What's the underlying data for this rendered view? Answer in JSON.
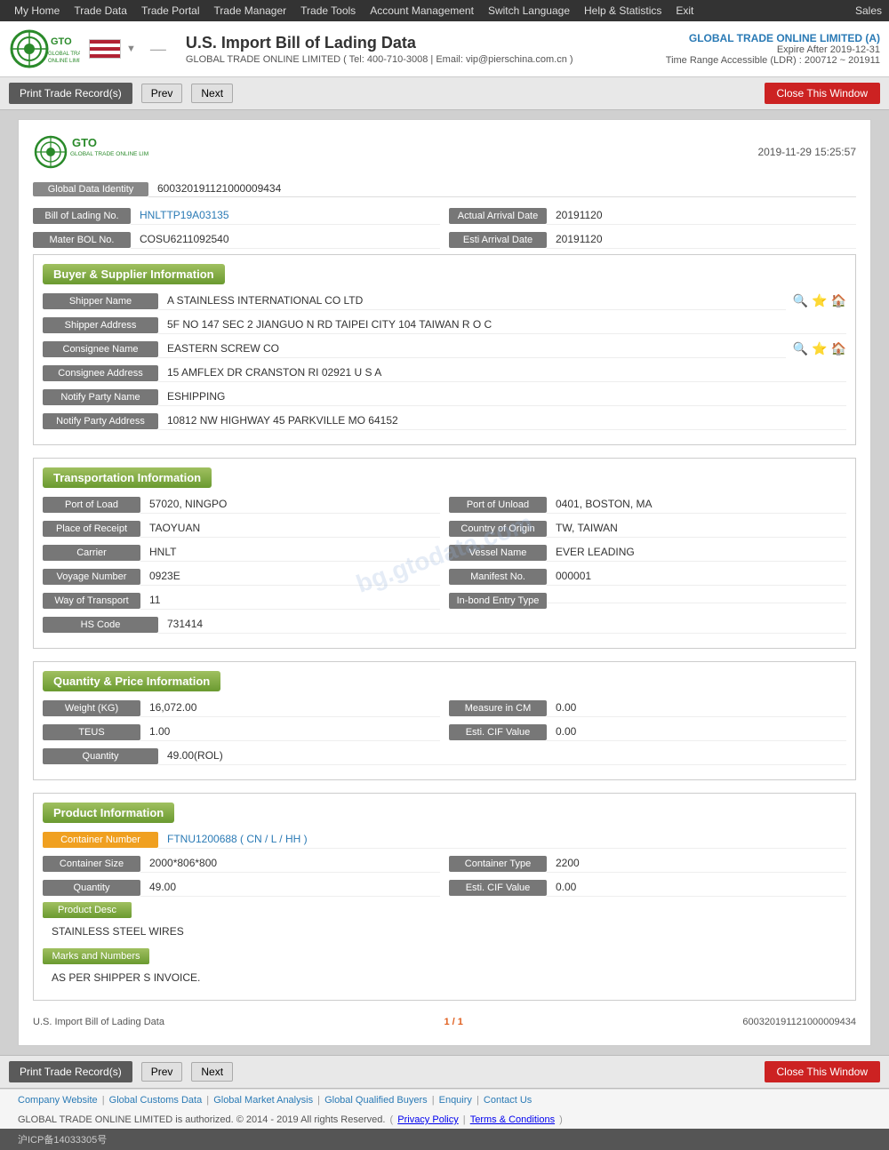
{
  "nav": {
    "items": [
      "My Home",
      "Trade Data",
      "Trade Portal",
      "Trade Manager",
      "Trade Tools",
      "Account Management",
      "Switch Language",
      "Help & Statistics",
      "Exit"
    ],
    "right": "Sales"
  },
  "header": {
    "title": "U.S. Import Bill of Lading Data",
    "subtitle": "GLOBAL TRADE ONLINE LIMITED ( Tel: 400-710-3008 | Email: vip@pierschina.com.cn )",
    "company": "GLOBAL TRADE ONLINE LIMITED (A)",
    "expire": "Expire After 2019-12-31",
    "ldr": "Time Range Accessible (LDR) : 200712 ~ 201911"
  },
  "toolbar": {
    "print_label": "Print Trade Record(s)",
    "prev_label": "Prev",
    "next_label": "Next",
    "close_label": "Close This Window"
  },
  "record": {
    "date": "2019-11-29 15:25:57",
    "global_data_identity_label": "Global Data Identity",
    "global_data_identity_value": "600320191121000009434",
    "bill_of_lading_no_label": "Bill of Lading No.",
    "bill_of_lading_no_value": "HNLTTP19A03135",
    "actual_arrival_date_label": "Actual Arrival Date",
    "actual_arrival_date_value": "20191120",
    "mater_bol_no_label": "Mater BOL No.",
    "mater_bol_no_value": "COSU6211092540",
    "esti_arrival_date_label": "Esti Arrival Date",
    "esti_arrival_date_value": "20191120"
  },
  "buyer_supplier": {
    "section_label": "Buyer & Supplier Information",
    "shipper_name_label": "Shipper Name",
    "shipper_name_value": "A STAINLESS INTERNATIONAL CO LTD",
    "shipper_address_label": "Shipper Address",
    "shipper_address_value": "5F NO 147 SEC 2 JIANGUO N RD TAIPEI CITY 104 TAIWAN R O C",
    "consignee_name_label": "Consignee Name",
    "consignee_name_value": "EASTERN SCREW CO",
    "consignee_address_label": "Consignee Address",
    "consignee_address_value": "15 AMFLEX DR CRANSTON RI 02921 U S A",
    "notify_party_name_label": "Notify Party Name",
    "notify_party_name_value": "ESHIPPING",
    "notify_party_address_label": "Notify Party Address",
    "notify_party_address_value": "10812 NW HIGHWAY 45 PARKVILLE MO 64152"
  },
  "transportation": {
    "section_label": "Transportation Information",
    "port_of_load_label": "Port of Load",
    "port_of_load_value": "57020, NINGPO",
    "port_of_unload_label": "Port of Unload",
    "port_of_unload_value": "0401, BOSTON, MA",
    "place_of_receipt_label": "Place of Receipt",
    "place_of_receipt_value": "TAOYUAN",
    "country_of_origin_label": "Country of Origin",
    "country_of_origin_value": "TW, TAIWAN",
    "carrier_label": "Carrier",
    "carrier_value": "HNLT",
    "vessel_name_label": "Vessel Name",
    "vessel_name_value": "EVER LEADING",
    "voyage_number_label": "Voyage Number",
    "voyage_number_value": "0923E",
    "manifest_no_label": "Manifest No.",
    "manifest_no_value": "000001",
    "way_of_transport_label": "Way of Transport",
    "way_of_transport_value": "11",
    "in_bond_entry_type_label": "In-bond Entry Type",
    "in_bond_entry_type_value": "",
    "hs_code_label": "HS Code",
    "hs_code_value": "731414"
  },
  "quantity_price": {
    "section_label": "Quantity & Price Information",
    "weight_kg_label": "Weight (KG)",
    "weight_kg_value": "16,072.00",
    "measure_in_cm_label": "Measure in CM",
    "measure_in_cm_value": "0.00",
    "teus_label": "TEUS",
    "teus_value": "1.00",
    "esti_cif_value_label": "Esti. CIF Value",
    "esti_cif_value_value": "0.00",
    "quantity_label": "Quantity",
    "quantity_value": "49.00(ROL)"
  },
  "product_info": {
    "section_label": "Product Information",
    "container_number_label": "Container Number",
    "container_number_value": "FTNU1200688 ( CN / L / HH )",
    "container_size_label": "Container Size",
    "container_size_value": "2000*806*800",
    "container_type_label": "Container Type",
    "container_type_value": "2200",
    "quantity_label": "Quantity",
    "quantity_value": "49.00",
    "esti_cif_value_label": "Esti. CIF Value",
    "esti_cif_value_value": "0.00",
    "product_desc_label": "Product Desc",
    "product_desc_value": "STAINLESS STEEL WIRES",
    "marks_and_numbers_label": "Marks and Numbers",
    "marks_and_numbers_value": "AS PER SHIPPER S INVOICE."
  },
  "page_footer": {
    "record_label": "U.S. Import Bill of Lading Data",
    "page": "1 / 1",
    "id": "600320191121000009434"
  },
  "footer": {
    "links": [
      "Company Website",
      "Global Customs Data",
      "Global Market Analysis",
      "Global Qualified Buyers",
      "Enquiry",
      "Contact Us"
    ],
    "copyright": "GLOBAL TRADE ONLINE LIMITED is authorized. © 2014 - 2019 All rights Reserved.",
    "privacy": "Privacy Policy",
    "terms": "Terms & Conditions",
    "icp": "沪ICP备14033305号"
  },
  "watermark": "bg.gtodata.com"
}
